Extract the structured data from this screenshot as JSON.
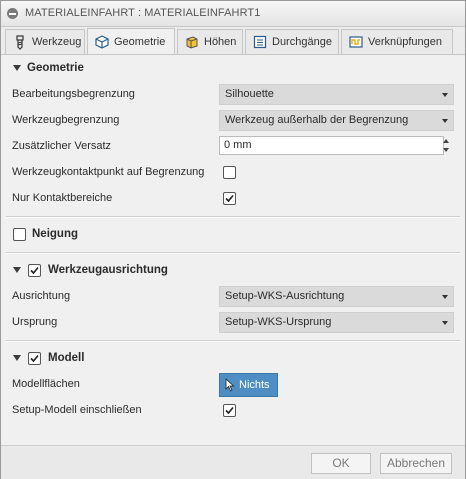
{
  "window": {
    "title": "MATERIALEINFAHRT : MATERIALEINFAHRT1"
  },
  "tabs": [
    {
      "label": "Werkzeug",
      "icon": "tool-icon"
    },
    {
      "label": "Geometrie",
      "icon": "geometry-cube-icon",
      "active": true
    },
    {
      "label": "Höhen",
      "icon": "heights-icon"
    },
    {
      "label": "Durchgänge",
      "icon": "passes-icon"
    },
    {
      "label": "Verknüpfungen",
      "icon": "linking-icon"
    }
  ],
  "geometry": {
    "title": "Geometrie",
    "rows": {
      "machining_boundary": {
        "label": "Bearbeitungsbegrenzung",
        "value": "Silhouette"
      },
      "tool_containment": {
        "label": "Werkzeugbegrenzung",
        "value": "Werkzeug außerhalb der Begrenzung"
      },
      "additional_offset": {
        "label": "Zusätzlicher Versatz",
        "value": "0 mm"
      },
      "contact_point": {
        "label": "Werkzeugkontaktpunkt auf Begrenzung",
        "checked": false
      },
      "contact_only": {
        "label": "Nur Kontaktbereiche",
        "checked": true
      }
    }
  },
  "tilt": {
    "title": "Neigung",
    "checked": false
  },
  "tool_orientation": {
    "title": "Werkzeugausrichtung",
    "checked": true,
    "rows": {
      "orientation": {
        "label": "Ausrichtung",
        "value": "Setup-WKS-Ausrichtung"
      },
      "origin": {
        "label": "Ursprung",
        "value": "Setup-WKS-Ursprung"
      }
    }
  },
  "model": {
    "title": "Modell",
    "checked": true,
    "rows": {
      "model_surfaces": {
        "label": "Modellflächen",
        "button": "Nichts"
      },
      "include_setup_model": {
        "label": "Setup-Modell einschließen",
        "checked": true
      }
    }
  },
  "footer": {
    "ok": "OK",
    "cancel": "Abbrechen"
  },
  "colors": {
    "selection_button": "#4f8ec4",
    "dialog_bg": "#f0f0f0"
  }
}
